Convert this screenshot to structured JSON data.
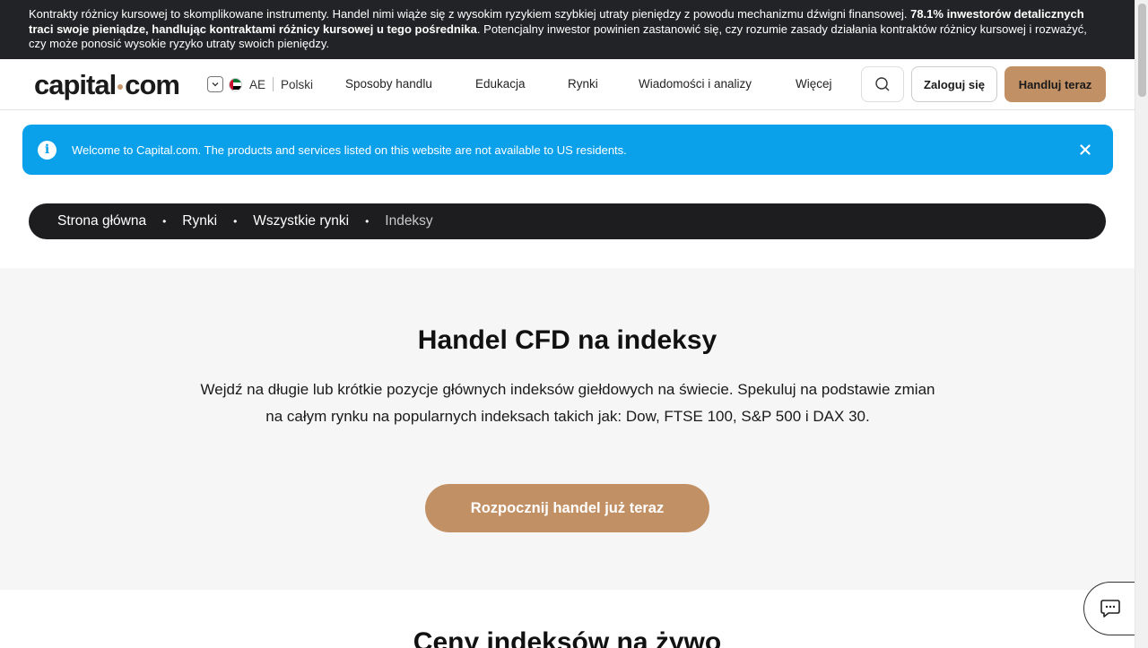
{
  "risk_banner": {
    "text_a": "Kontrakty różnicy kursowej to skomplikowane instrumenty. Handel nimi wiąże się z wysokim ryzykiem szybkiej utraty pieniędzy z powodu mechanizmu dźwigni finansowej. ",
    "text_bold": "78.1% inwestorów detalicznych traci swoje pieniądze, handlując kontraktami różnicy kursowej u tego pośrednika",
    "text_b": ". Potencjalny inwestor powinien zastanowić się, czy rozumie zasady działania kontraktów różnicy kursowej i rozważyć, czy może ponosić wysokie ryzyko utraty swoich pieniędzy."
  },
  "header": {
    "logo_part1": "capital",
    "logo_part2": "com",
    "region_code": "AE",
    "language": "Polski",
    "nav": [
      "Sposoby handlu",
      "Edukacja",
      "Rynki",
      "Wiadomości i analizy",
      "Więcej"
    ],
    "login_label": "Zaloguj się",
    "trade_label": "Handluj teraz"
  },
  "alert": {
    "text": "Welcome to Capital.com. The products and services listed on this website are not available to US residents."
  },
  "breadcrumb": [
    "Strona główna",
    "Rynki",
    "Wszystkie rynki",
    "Indeksy"
  ],
  "hero": {
    "title": "Handel CFD na indeksy",
    "description": "Wejdź na długie lub krótkie pozycje głównych indeksów giełdowych na świecie. Spekuluj na podstawie zmian na całym rynku na popularnych indeksach takich jak: Dow, FTSE 100, S&P 500 i DAX 30.",
    "cta_label": "Rozpocznij handel już teraz"
  },
  "section2_title": "Ceny indeksów na żywo",
  "colors": {
    "accent": "#c29065",
    "alert_bg": "#0aa0ea",
    "dark": "#1d1d1f"
  },
  "icons": {
    "locale_toggle": "chevron-down-icon",
    "flag": "uae-flag-icon",
    "search": "search-icon",
    "alert_info": "info-icon",
    "alert_close": "close-icon",
    "chat": "chat-icon"
  }
}
